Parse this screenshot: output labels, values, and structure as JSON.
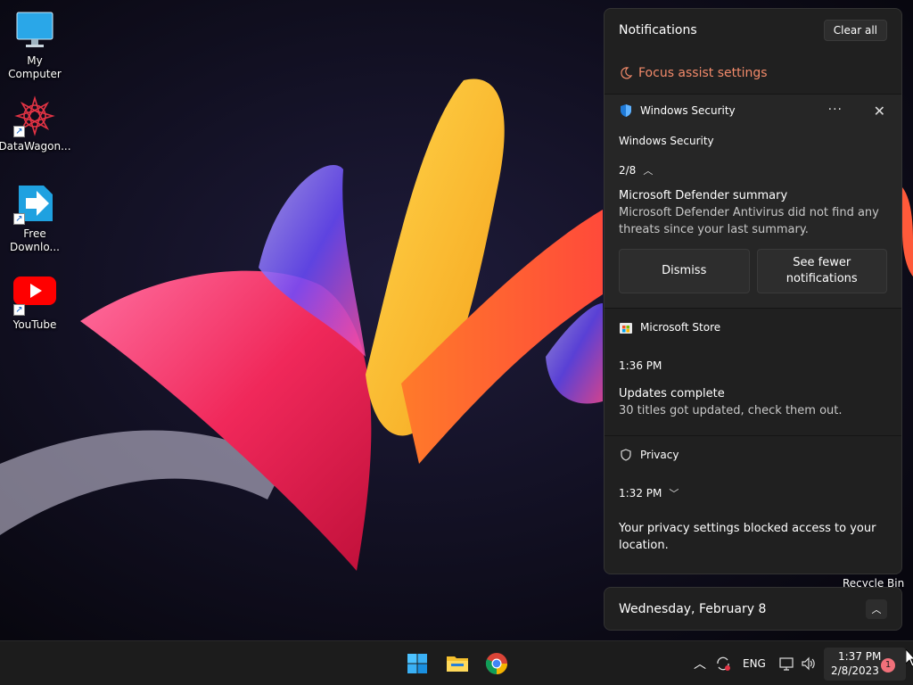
{
  "desktop": {
    "icons": [
      {
        "label": "My Computer",
        "icon": "monitor-icon"
      },
      {
        "label": "DataWagon...",
        "icon": "datawagon-icon"
      },
      {
        "label": "Free\nDownlo...",
        "icon": "free-download-manager-icon"
      },
      {
        "label": "YouTube",
        "icon": "youtube-icon"
      }
    ],
    "recycle_bin_label": "Recycle Bin"
  },
  "notifications": {
    "title": "Notifications",
    "clear_all": "Clear all",
    "focus_assist": "Focus assist settings",
    "groups": [
      {
        "app": "Windows Security",
        "icon": "shield-icon",
        "sub_title": "Windows Security",
        "counter": "2/8",
        "title": "Microsoft Defender summary",
        "body": "Microsoft Defender Antivirus did not find any threats since your last summary.",
        "actions": [
          "Dismiss",
          "See fewer notifications"
        ]
      },
      {
        "app": "Microsoft Store",
        "icon": "store-icon",
        "time": "1:36 PM",
        "title": "Updates complete",
        "body": "30 titles got updated, check them out."
      },
      {
        "app": "Privacy",
        "icon": "privacy-shield-icon",
        "time": "1:32 PM",
        "title": "Your privacy settings blocked access to your location."
      }
    ]
  },
  "calendar": {
    "date": "Wednesday, February 8"
  },
  "taskbar": {
    "apps": [
      "start-icon",
      "file-explorer-icon",
      "chrome-icon"
    ],
    "tray": {
      "language": "ENG",
      "time": "1:37 PM",
      "date": "2/8/2023",
      "badge": "1"
    }
  },
  "colors": {
    "accent_focus": "#f28a6a",
    "panel_bg": "#202020",
    "badge": "#f1707a"
  }
}
